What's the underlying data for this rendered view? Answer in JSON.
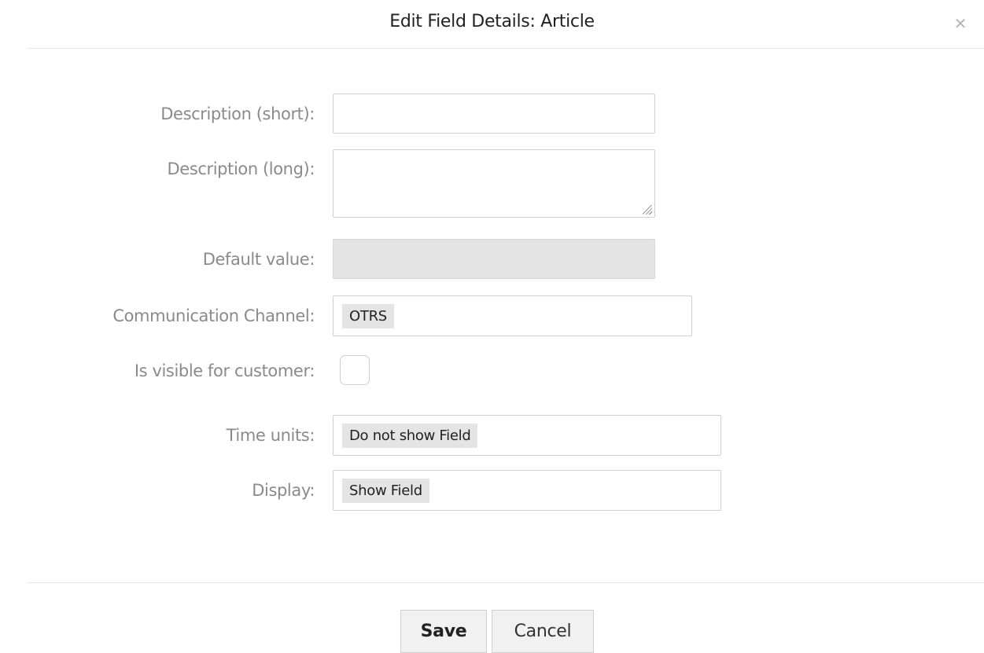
{
  "dialog": {
    "title": "Edit Field Details: Article",
    "close_icon": "close-icon"
  },
  "form": {
    "description_short": {
      "label": "Description (short):",
      "value": ""
    },
    "description_long": {
      "label": "Description (long):",
      "value": ""
    },
    "default_value": {
      "label": "Default value:",
      "value": ""
    },
    "communication_channel": {
      "label": "Communication Channel:",
      "value": "OTRS"
    },
    "visible_for_customer": {
      "label": "Is visible for customer:",
      "checked": false
    },
    "time_units": {
      "label": "Time units:",
      "value": "Do not show Field"
    },
    "display": {
      "label": "Display:",
      "value": "Show Field"
    }
  },
  "footer": {
    "save_label": "Save",
    "cancel_label": "Cancel"
  },
  "colors": {
    "label_text": "#8a8a8a",
    "border": "#cfcfcf",
    "chip_bg": "#e4e4e4",
    "disabled_bg": "#e3e3e3"
  }
}
